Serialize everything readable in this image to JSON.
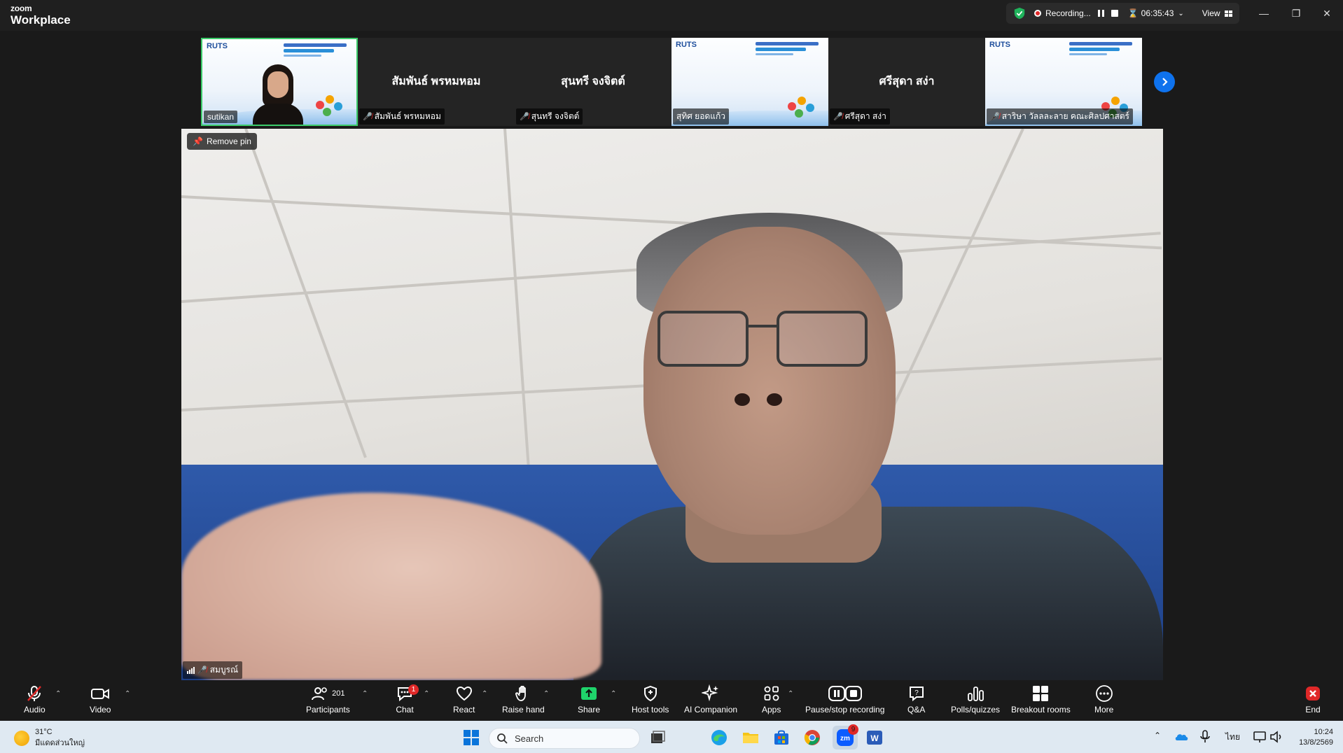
{
  "app": {
    "brand_line1": "zoom",
    "brand_line2": "Workplace"
  },
  "recording": {
    "status": "Recording...",
    "timer": "06:35:43",
    "view_label": "View"
  },
  "gallery": {
    "tiles": [
      {
        "name": "sutikan",
        "type": "video",
        "mic_muted": false,
        "active": true
      },
      {
        "name": "สัมพันธ์ พรหมหอม",
        "label": "สัมพันธ์ พรหมหอม",
        "type": "name",
        "mic_muted": true
      },
      {
        "name": "สุนทรี จงจิตต์",
        "label": "สุนทรี จงจิตต์",
        "type": "name",
        "mic_muted": true
      },
      {
        "name": "สุทิศ ยอดแก้ว",
        "type": "slide",
        "mic_muted": false
      },
      {
        "name": "ศรีสุดา สง่า",
        "label": "ศรีสุดา สง่า",
        "type": "name",
        "mic_muted": true
      },
      {
        "name": "สาริษา วัลลละลาย คณะศิลปศาสตร์",
        "type": "slide",
        "mic_muted": true
      }
    ],
    "slide_logo": "RUTS"
  },
  "main": {
    "speaker_name": "สมบูรณ์",
    "remove_pin_label": "Remove pin"
  },
  "toolbar": {
    "audio": "Audio",
    "video": "Video",
    "participants": "Participants",
    "participants_count": "201",
    "chat": "Chat",
    "chat_badge": "1",
    "react": "React",
    "raise_hand": "Raise hand",
    "share": "Share",
    "host_tools": "Host tools",
    "ai_companion": "AI Companion",
    "apps": "Apps",
    "pause_stop": "Pause/stop recording",
    "qa": "Q&A",
    "polls": "Polls/quizzes",
    "breakout": "Breakout rooms",
    "more": "More",
    "end": "End"
  },
  "taskbar": {
    "weather_temp": "31°C",
    "weather_desc": "มีแดดส่วนใหญ่",
    "search_placeholder": "Search",
    "zoom_badge": "9",
    "lang": "ไทย",
    "time": "10:24",
    "date": "13/8/2569"
  },
  "colors": {
    "accent": "#0e72ed",
    "active_border": "#3ccc6a",
    "danger": "#e02828",
    "share_green": "#1fd46b"
  }
}
